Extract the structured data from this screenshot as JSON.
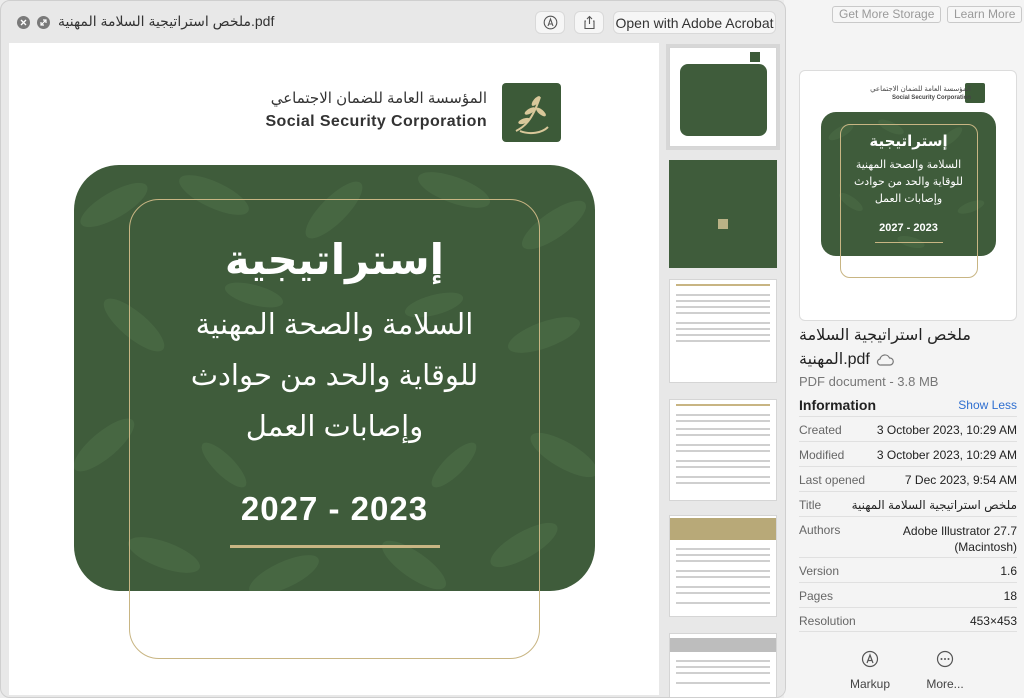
{
  "background": {
    "buttons": [
      "Get More Storage",
      "Learn More"
    ]
  },
  "window": {
    "filename": "ملخص استراتيجية السلامة المهنية.pdf",
    "open_with": "Open with Adobe Acrobat",
    "icons": [
      "close-icon",
      "fullscreen-icon",
      "markup-icon",
      "share-icon"
    ]
  },
  "document": {
    "org_arabic": "المؤسسة العامة للضمان الاجتماعي",
    "org_english": "Social Security Corporation",
    "cover_title": "إستراتيجية",
    "cover_lines": [
      "السلامة والصحة المهنية",
      "للوقاية والحد من حوادث",
      "وإصابات العمل"
    ],
    "cover_years": "2027 - 2023"
  },
  "sidebar": {
    "file_name_line1": "ملخص استراتيجية السلامة",
    "file_name_line2": "المهنية.pdf",
    "file_kind": "PDF document - 3.8 MB",
    "info_title": "Information",
    "show_less": "Show Less",
    "rows": [
      {
        "label": "Created",
        "value": "3 October 2023, 10:29 AM"
      },
      {
        "label": "Modified",
        "value": "3 October 2023, 10:29 AM"
      },
      {
        "label": "Last opened",
        "value": "7 Dec 2023, 9:54 AM"
      },
      {
        "label": "Title",
        "value": "ملخص استراتيجية السلامة المهنية"
      },
      {
        "label": "Authors",
        "value": "Adobe Illustrator 27.7 (Macintosh)"
      },
      {
        "label": "Version",
        "value": "1.6"
      },
      {
        "label": "Pages",
        "value": "18"
      },
      {
        "label": "Resolution",
        "value": "453×453"
      }
    ],
    "markup_label": "Markup",
    "more_label": "More..."
  },
  "colors": {
    "cover_green": "#3f5c3b",
    "gold": "#c8b583",
    "link_blue": "#2f6fd0"
  }
}
